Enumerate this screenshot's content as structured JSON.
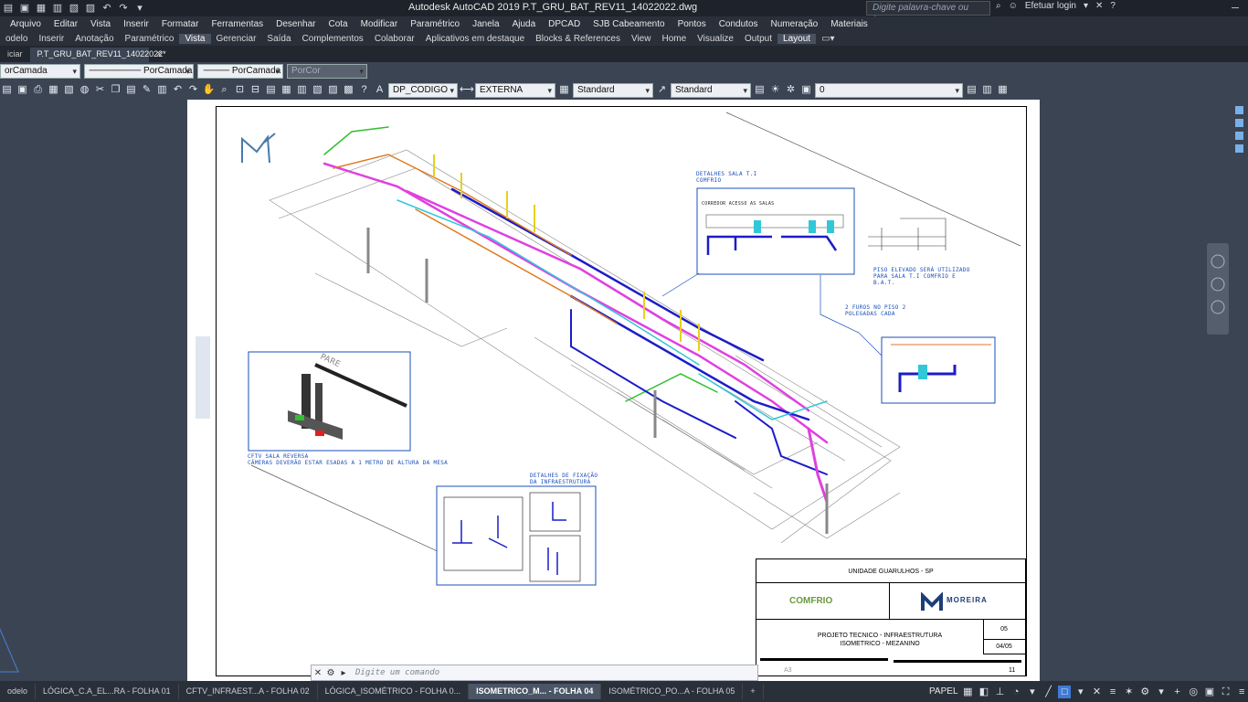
{
  "titlebar": {
    "app_title": "Autodesk AutoCAD 2019    P.T_GRU_BAT_REV11_14022022.dwg",
    "search_placeholder": "Digite palavra-chave ou frase",
    "login_label": "Efetuar login"
  },
  "menu": [
    "Arquivo",
    "Editar",
    "Vista",
    "Inserir",
    "Formatar",
    "Ferramentas",
    "Desenhar",
    "Cota",
    "Modificar",
    "Paramétrico",
    "Janela",
    "Ajuda",
    "DPCAD",
    "SJB Cabeamento",
    "Pontos",
    "Condutos",
    "Numeração",
    "Materiais"
  ],
  "ribbon_tabs": [
    {
      "label": "odelo"
    },
    {
      "label": "Inserir"
    },
    {
      "label": "Anotação"
    },
    {
      "label": "Paramétrico"
    },
    {
      "label": "Vista",
      "active": true
    },
    {
      "label": "Gerenciar"
    },
    {
      "label": "Saída"
    },
    {
      "label": "Complementos"
    },
    {
      "label": "Colaborar"
    },
    {
      "label": "Aplicativos em destaque"
    },
    {
      "label": "Blocks & References"
    },
    {
      "label": "View"
    },
    {
      "label": "Home"
    },
    {
      "label": "Visualize"
    },
    {
      "label": "Output"
    },
    {
      "label": "Layout",
      "active": true
    }
  ],
  "doc_tabs": {
    "start": "iciar",
    "current": "P.T_GRU_BAT_REV11_14022022*"
  },
  "properties": {
    "layer": "orCamada",
    "linetype": "PorCamada",
    "lineweight": "PorCamada",
    "color": "PorCor"
  },
  "toolbar": {
    "text_style": "DP_CODIGO",
    "dim_style": "EXTERNA",
    "table_style": "Standard",
    "multileader_style": "Standard",
    "layer_current": "0"
  },
  "drawing": {
    "labels": {
      "detail_ti": "DETALHES SALA T.I COMFRIO",
      "corridor": "CORREDOR ACESSO AS SALAS",
      "raised_floor": "PISO ELEVADO SERÁ UTILIZADO PARA SALA T.I COMFRIO E B.A.T.",
      "holes": "2 FUROS NO PISO 2 POLEGADAS CADA",
      "cftv_title": "CFTV SALA REVERSA",
      "cftv_note": "CÂMERAS DEVERÃO ESTAR ESADAS A 1 METRO DE ALTURA DA MESA",
      "fixing_details": "DETALHES DE FIXAÇÃO DA INFRAESTRUTURA"
    },
    "title_block": {
      "unit": "UNIDADE GUARULHOS - SP",
      "client_logo": "COMFRIO",
      "company_logo": "MOREIRA",
      "project_line1": "PROJETO TECNICO - INFRAESTRUTURA",
      "project_line2": "ISOMETRICO - MEZANINO",
      "sheet_no": "05",
      "sheet_count": "04/05",
      "format": "A3",
      "rev": "11"
    }
  },
  "command_line": {
    "placeholder": "Digite um comando"
  },
  "layout_tabs": [
    {
      "label": "odelo"
    },
    {
      "label": "LÓGICA_C.A_EL...RA - FOLHA 01"
    },
    {
      "label": "CFTV_INFRAEST...A - FOLHA 02"
    },
    {
      "label": "LÓGICA_ISOMÉTRICO - FOLHA 0..."
    },
    {
      "label": "ISOMETRICO_M... - FOLHA 04",
      "active": true
    },
    {
      "label": "ISOMÉTRICO_PO...A - FOLHA 05"
    },
    {
      "label": "+"
    }
  ],
  "status": {
    "space": "PAPEL"
  },
  "colors": {
    "accent": "#3f7bd6",
    "pipe_blue": "#1c1cc8",
    "pipe_magenta": "#e040e0",
    "pipe_orange": "#e07a20",
    "pipe_cyan": "#30c8d8",
    "pipe_yellow": "#e8d020",
    "pipe_green": "#30c030"
  }
}
